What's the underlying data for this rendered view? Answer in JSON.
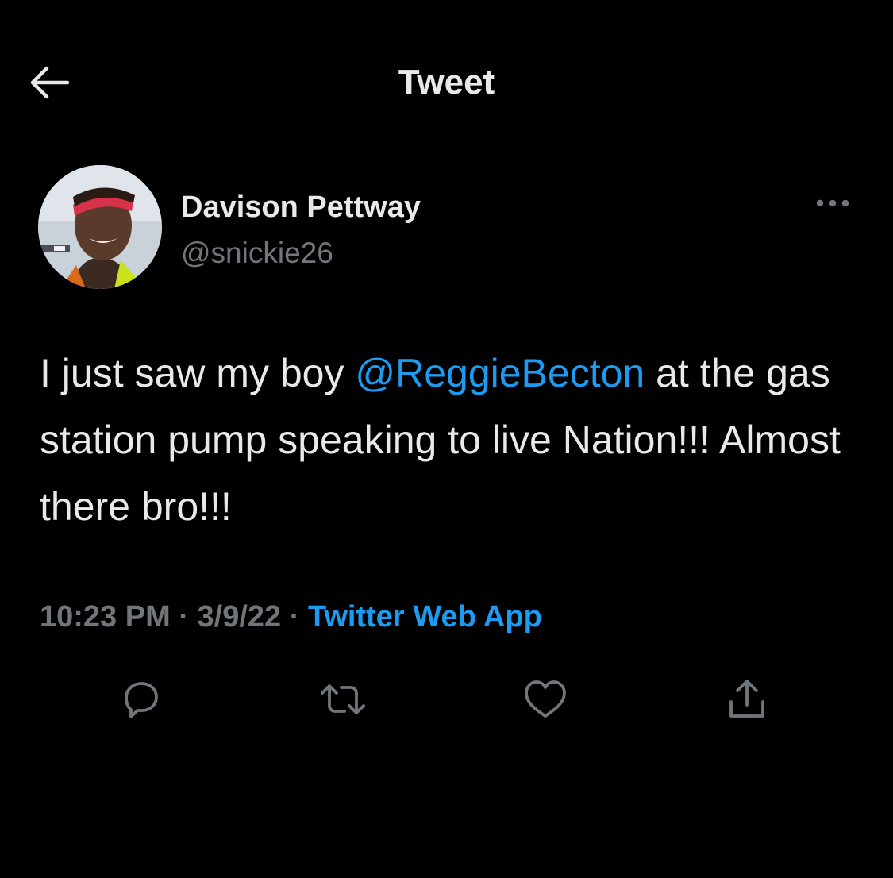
{
  "header": {
    "title": "Tweet",
    "back_icon": "back-arrow-icon"
  },
  "author": {
    "display_name": "Davison Pettway",
    "handle": "@snickie26",
    "avatar_icon": "avatar-photo"
  },
  "tweet": {
    "text_before": "I just saw my boy ",
    "mention": "@ReggieBecton",
    "text_after": " at the gas station pump speaking to live Nation!!! Almost there bro!!!"
  },
  "meta": {
    "time": "10:23 PM",
    "separator": " · ",
    "date": "3/9/22",
    "source": "Twitter Web App"
  },
  "actions": {
    "reply_icon": "reply-icon",
    "retweet_icon": "retweet-icon",
    "like_icon": "heart-icon",
    "share_icon": "share-icon"
  },
  "colors": {
    "background": "#000000",
    "text": "#e7e9ea",
    "secondary": "#71767b",
    "accent": "#1d9bf0"
  }
}
